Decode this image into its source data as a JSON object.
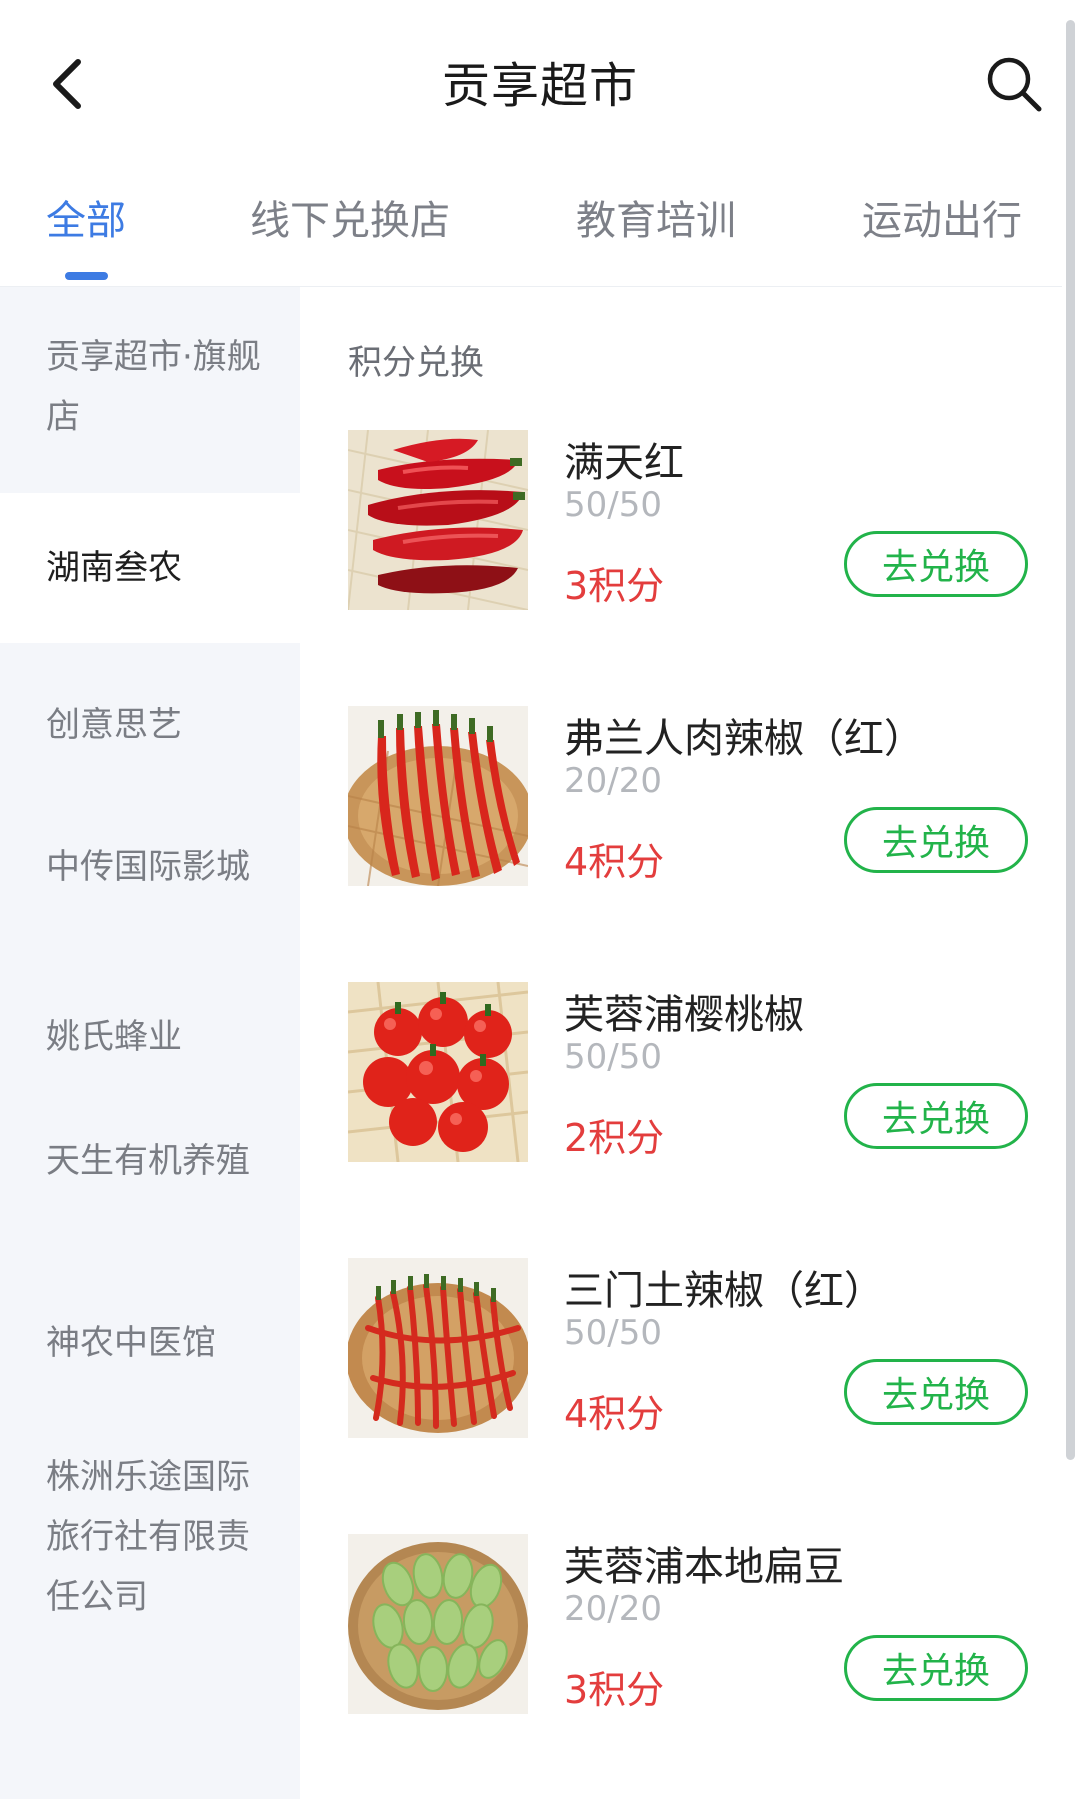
{
  "header": {
    "title": "贡享超市",
    "back_icon": "chevron-left-icon",
    "search_icon": "search-icon"
  },
  "tabs": [
    {
      "label": "全部",
      "active": true
    },
    {
      "label": "线下兑换店",
      "active": false
    },
    {
      "label": "教育培训",
      "active": false
    },
    {
      "label": "运动出行",
      "active": false
    }
  ],
  "sidebar": {
    "items": [
      {
        "label": "贡享超市·旗舰店",
        "active": false
      },
      {
        "label": "湖南叁农",
        "active": true
      },
      {
        "label": "创意思艺",
        "active": false
      },
      {
        "label": "中传国际影城",
        "active": false
      },
      {
        "label": "姚氏蜂业",
        "active": false
      },
      {
        "label": "天生有机养殖",
        "active": false
      },
      {
        "label": "神农中医馆",
        "active": false
      },
      {
        "label": "株洲乐途国际旅行社有限责任公司",
        "active": false
      }
    ]
  },
  "main": {
    "section_title": "积分兑换",
    "products": [
      {
        "name": "满天红",
        "stock": "50/50",
        "points": "3积分",
        "button": "去兑换",
        "image": "red-pepper-image"
      },
      {
        "name": "弗兰人肉辣椒（红）",
        "stock": "20/20",
        "points": "4积分",
        "button": "去兑换",
        "image": "long-chili-image"
      },
      {
        "name": "芙蓉浦樱桃椒",
        "stock": "50/50",
        "points": "2积分",
        "button": "去兑换",
        "image": "cherry-pepper-image"
      },
      {
        "name": "三门土辣椒（红）",
        "stock": "50/50",
        "points": "4积分",
        "button": "去兑换",
        "image": "thin-chili-image"
      },
      {
        "name": "芙蓉浦本地扁豆",
        "stock": "20/20",
        "points": "3积分",
        "button": "去兑换",
        "image": "flat-bean-image"
      }
    ]
  },
  "colors": {
    "accent": "#3d7be3",
    "points_red": "#e33d3d",
    "button_green": "#22b34a",
    "sidebar_bg": "#f4f6fa"
  }
}
